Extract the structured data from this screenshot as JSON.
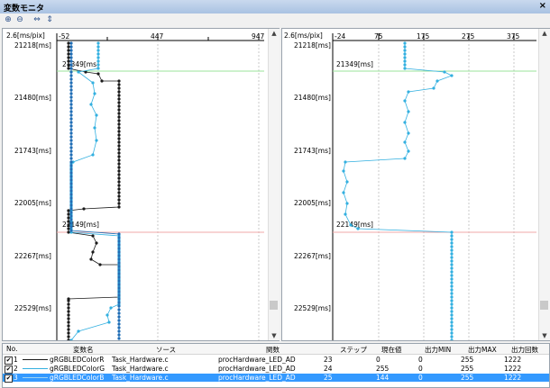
{
  "window": {
    "title": "変数モニタ",
    "close_glyph": "×"
  },
  "toolbar": {
    "buttons": [
      {
        "name": "zoom-in-icon",
        "glyph": "⊕"
      },
      {
        "name": "zoom-out-icon",
        "glyph": "⊖"
      },
      {
        "name": "fit-horizontal-icon",
        "glyph": "⇔"
      },
      {
        "name": "fit-vertical-icon",
        "glyph": "⇕"
      }
    ]
  },
  "colors": {
    "series1": "#1a1a1a",
    "series2": "#33b0e0",
    "series3": "#1f6db5",
    "marker_green": "#9be39b",
    "marker_red": "#f2a8a8"
  },
  "left_plot": {
    "scale_label": "2.6[ms/pix]",
    "x_ticks": [
      "-52",
      "447",
      "947"
    ],
    "y_ticks": [
      "21218[ms]",
      "21480[ms]",
      "21743[ms]",
      "22005[ms]",
      "22267[ms]",
      "22529[ms]"
    ],
    "markers": [
      "21349[ms]",
      "22149[ms]"
    ]
  },
  "right_plot": {
    "scale_label": "2.6[ms/pix]",
    "x_ticks": [
      "-24",
      "75",
      "175",
      "275",
      "375"
    ],
    "y_ticks": [
      "21218[ms]",
      "21480[ms]",
      "21743[ms]",
      "22005[ms]",
      "22267[ms]",
      "22529[ms]"
    ],
    "markers": [
      "21349[ms]",
      "22149[ms]"
    ]
  },
  "table": {
    "headers": [
      "No.",
      "変数名",
      "ソース",
      "関数",
      "ステップ",
      "現在値",
      "出力MIN",
      "出力MAX",
      "出力回数"
    ],
    "rows": [
      {
        "no": "1",
        "checked": "✔",
        "name": "gRGBLEDColorR",
        "source": "Task_Hardware.c",
        "func": "procHardware_LED_AD",
        "step": "23",
        "value": "0",
        "min": "0",
        "max": "255",
        "count": "1222"
      },
      {
        "no": "2",
        "checked": "✔",
        "name": "gRGBLEDColorG",
        "source": "Task_Hardware.c",
        "func": "procHardware_LED_AD",
        "step": "24",
        "value": "255",
        "min": "0",
        "max": "255",
        "count": "1222"
      },
      {
        "no": "3",
        "checked": "✔",
        "name": "gRGBLEDColorB",
        "source": "Task_Hardware.c",
        "func": "procHardware_LED_AD",
        "step": "25",
        "value": "144",
        "min": "0",
        "max": "255",
        "count": "1222"
      }
    ]
  }
}
